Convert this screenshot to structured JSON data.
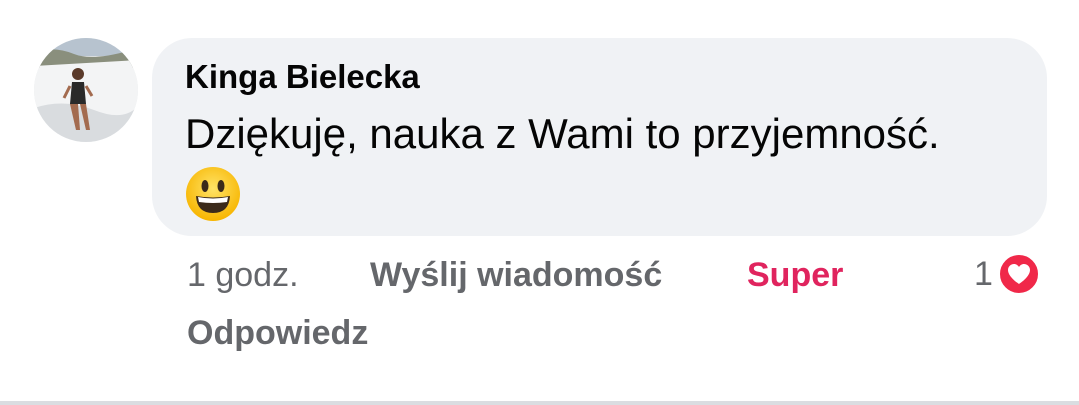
{
  "comment": {
    "author": "Kinga Bielecka",
    "text": "Dziękuję, nauka z Wami to przyjemność.",
    "emoji": "grinning-face-emoji"
  },
  "actions": {
    "time": "1 godz.",
    "send_message": "Wyślij wiadomość",
    "reaction": "Super",
    "reply": "Odpowiedz"
  },
  "reactions": {
    "count": "1",
    "icon": "heart-icon"
  },
  "colors": {
    "bubble": "#f0f2f5",
    "reaction_accent": "#e0245e",
    "heart": "#f02849",
    "meta_text": "#65676b"
  }
}
